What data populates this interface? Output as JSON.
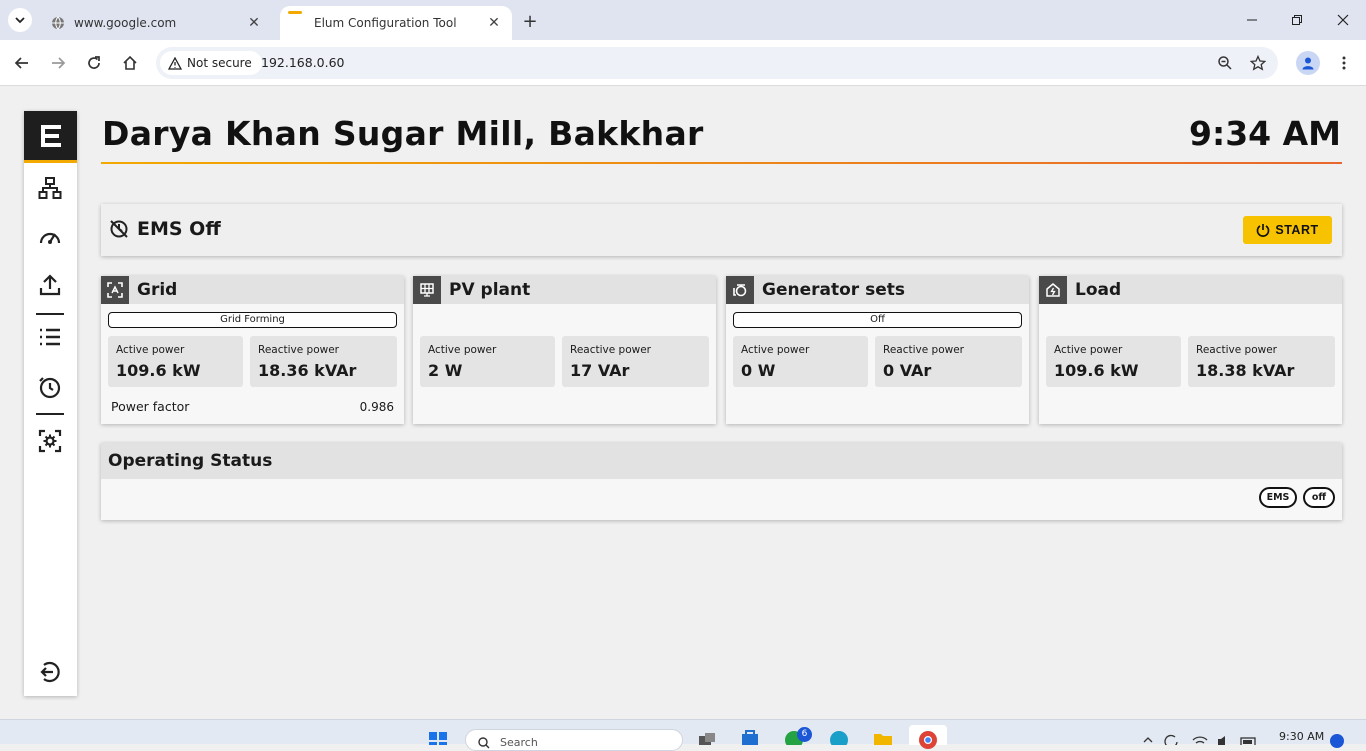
{
  "browser": {
    "tabs": [
      {
        "title": "www.google.com"
      },
      {
        "title": "Elum Configuration Tool"
      }
    ],
    "security_label": "Not secure",
    "url": "192.168.0.60"
  },
  "header": {
    "title": "Darya Khan Sugar Mill, Bakkhar",
    "time": "9:34 AM"
  },
  "ems": {
    "status": "EMS Off",
    "start_label": "START"
  },
  "cards": {
    "grid": {
      "title": "Grid",
      "mode": "Grid Forming",
      "active_label": "Active power",
      "active_value": "109.6 kW",
      "reactive_label": "Reactive power",
      "reactive_value": "18.36 kVAr",
      "pf_label": "Power factor",
      "pf_value": "0.986"
    },
    "pv": {
      "title": "PV plant",
      "active_label": "Active power",
      "active_value": "2 W",
      "reactive_label": "Reactive power",
      "reactive_value": "17 VAr"
    },
    "gen": {
      "title": "Generator sets",
      "mode": "Off",
      "active_label": "Active power",
      "active_value": "0 W",
      "reactive_label": "Reactive power",
      "reactive_value": "0 VAr"
    },
    "load": {
      "title": "Load",
      "active_label": "Active power",
      "active_value": "109.6 kW",
      "reactive_label": "Reactive power",
      "reactive_value": "18.38 kVAr"
    }
  },
  "operating_status": {
    "title": "Operating Status",
    "pills": [
      "EMS",
      "off"
    ]
  },
  "taskbar": {
    "search_placeholder": "Search",
    "badge_count": "6",
    "time": "9:30 AM"
  },
  "colors": {
    "accent": "#f2a900",
    "start_button": "#f7c200",
    "gradient_end": "#e8672e"
  }
}
